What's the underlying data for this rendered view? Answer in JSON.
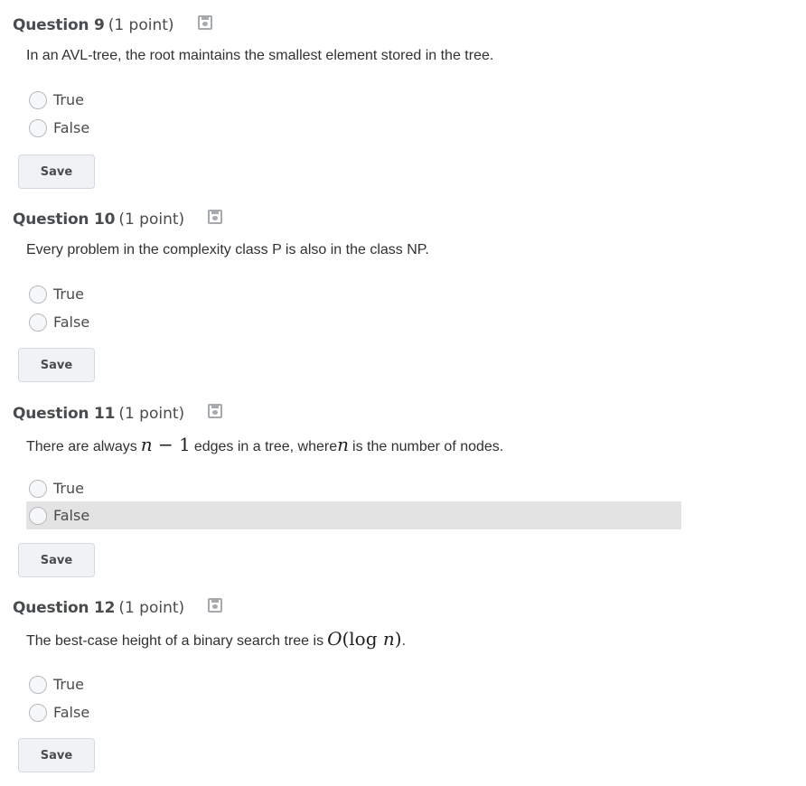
{
  "questions": [
    {
      "title": "Question 9",
      "points": "(1 point)",
      "icon": "save-status-icon",
      "text_parts": [
        "In an AVL-tree, the root maintains the smallest element stored in the tree."
      ],
      "options": [
        "True",
        "False"
      ],
      "save_label": "Save"
    },
    {
      "title": "Question 10",
      "points": "(1 point)",
      "icon": "save-status-icon",
      "text_parts": [
        "Every problem in the complexity class P is also in the class NP."
      ],
      "options": [
        "True",
        "False"
      ],
      "save_label": "Save"
    },
    {
      "title": "Question 11",
      "points": "(1 point)",
      "icon": "save-status-icon",
      "text_parts": [
        "There are always ",
        "n",
        " − 1",
        " edges in a tree, where ",
        "n",
        " is the number of nodes."
      ],
      "options": [
        "True",
        "False"
      ],
      "highlighted_option": "False",
      "save_label": "Save"
    },
    {
      "title": "Question 12",
      "points": "(1 point)",
      "icon": "save-status-icon",
      "text_parts": [
        "The best-case height of a binary search tree is ",
        "O",
        "(log ",
        "n",
        ")",
        "."
      ],
      "options": [
        "True",
        "False"
      ],
      "save_label": "Save"
    }
  ],
  "colors": {
    "highlight": "#e3e3e3",
    "button_bg": "#f1f2f4",
    "text": "#494c4e"
  }
}
